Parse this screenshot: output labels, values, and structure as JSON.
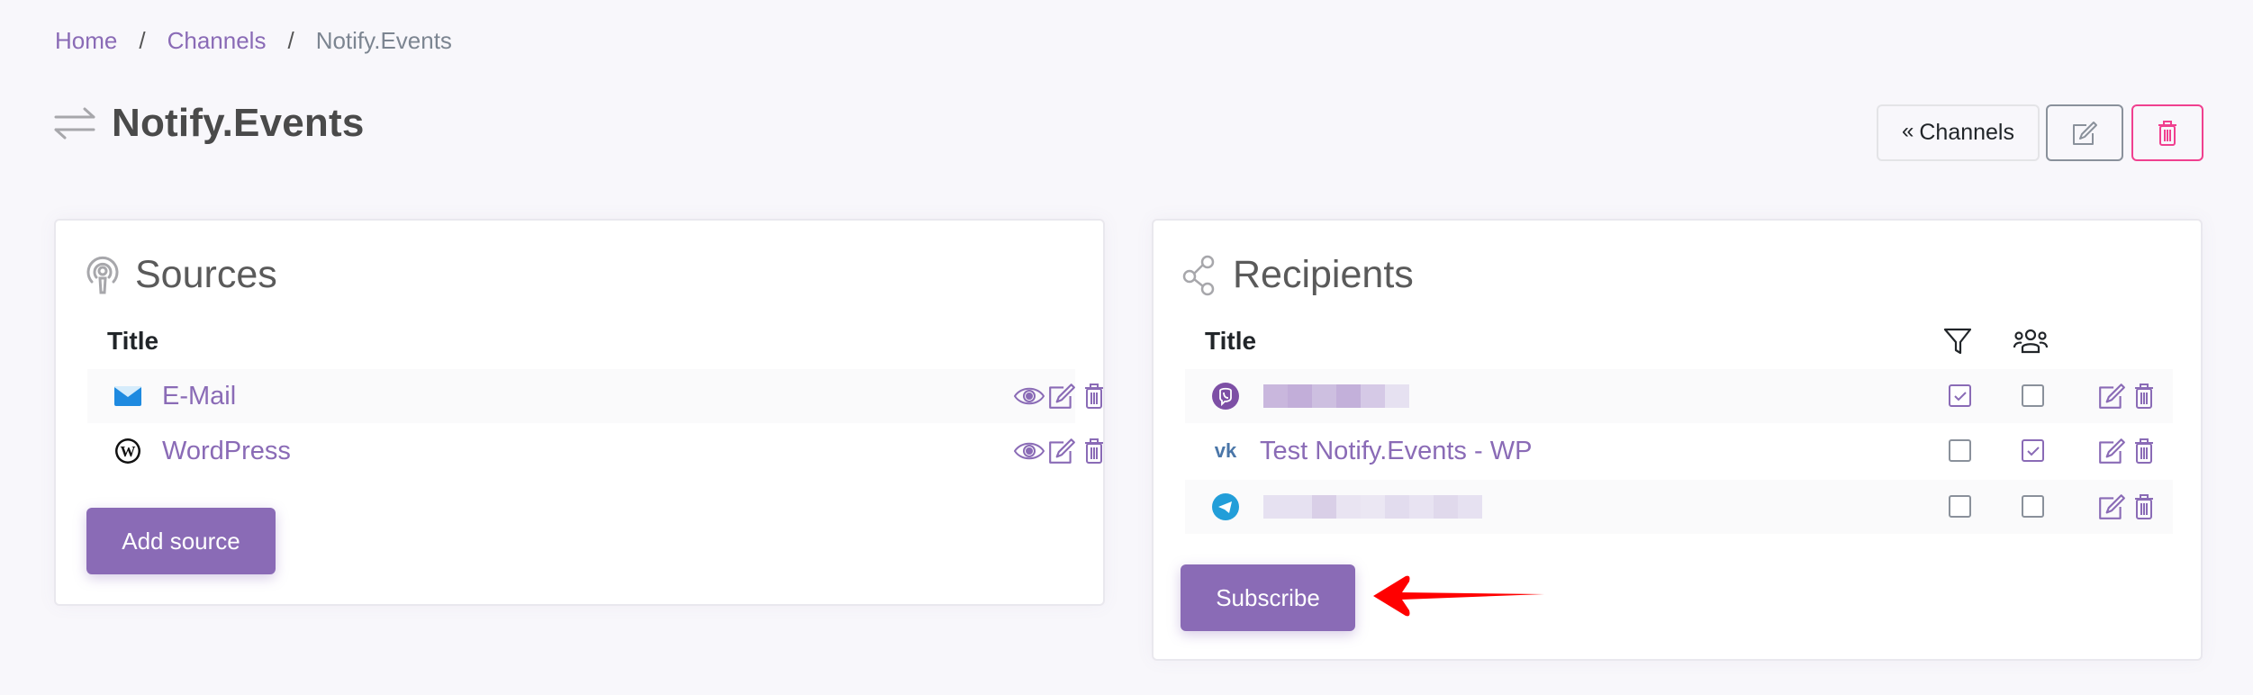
{
  "breadcrumb": {
    "items": [
      "Home",
      "Channels",
      "Notify.Events"
    ],
    "separator": "/"
  },
  "page": {
    "title": "Notify.Events",
    "title_icon": "arrows-exchange-icon"
  },
  "header_actions": {
    "back_label": "Channels",
    "back_chevron": "«",
    "edit_icon": "edit-icon",
    "delete_icon": "trash-icon"
  },
  "sources": {
    "title": "Sources",
    "icon": "broadcast-icon",
    "column_title": "Title",
    "rows": [
      {
        "title": "E-Mail",
        "icon": "email-icon",
        "actions": [
          "view",
          "edit",
          "delete"
        ]
      },
      {
        "title": "WordPress",
        "icon": "wordpress-icon",
        "actions": [
          "view",
          "edit",
          "delete"
        ]
      }
    ],
    "add_button": "Add source"
  },
  "recipients": {
    "title": "Recipients",
    "icon": "share-icon",
    "column_title": "Title",
    "column_filter_icon": "filter-icon",
    "column_group_icon": "users-group-icon",
    "rows": [
      {
        "title": "[redacted]",
        "icon": "viber-icon",
        "redacted": true,
        "filter": true,
        "group": false
      },
      {
        "title": "Test Notify.Events - WP",
        "icon": "vk-icon",
        "redacted": false,
        "filter": false,
        "group": true
      },
      {
        "title": "[redacted]",
        "icon": "telegram-icon",
        "redacted": true,
        "filter": false,
        "group": false
      }
    ],
    "subscribe_button": "Subscribe"
  },
  "colors": {
    "accent": "#8a6bb6",
    "danger": "#f0408f",
    "background": "#f8f7fb",
    "annotation_arrow": "#ff0000"
  }
}
